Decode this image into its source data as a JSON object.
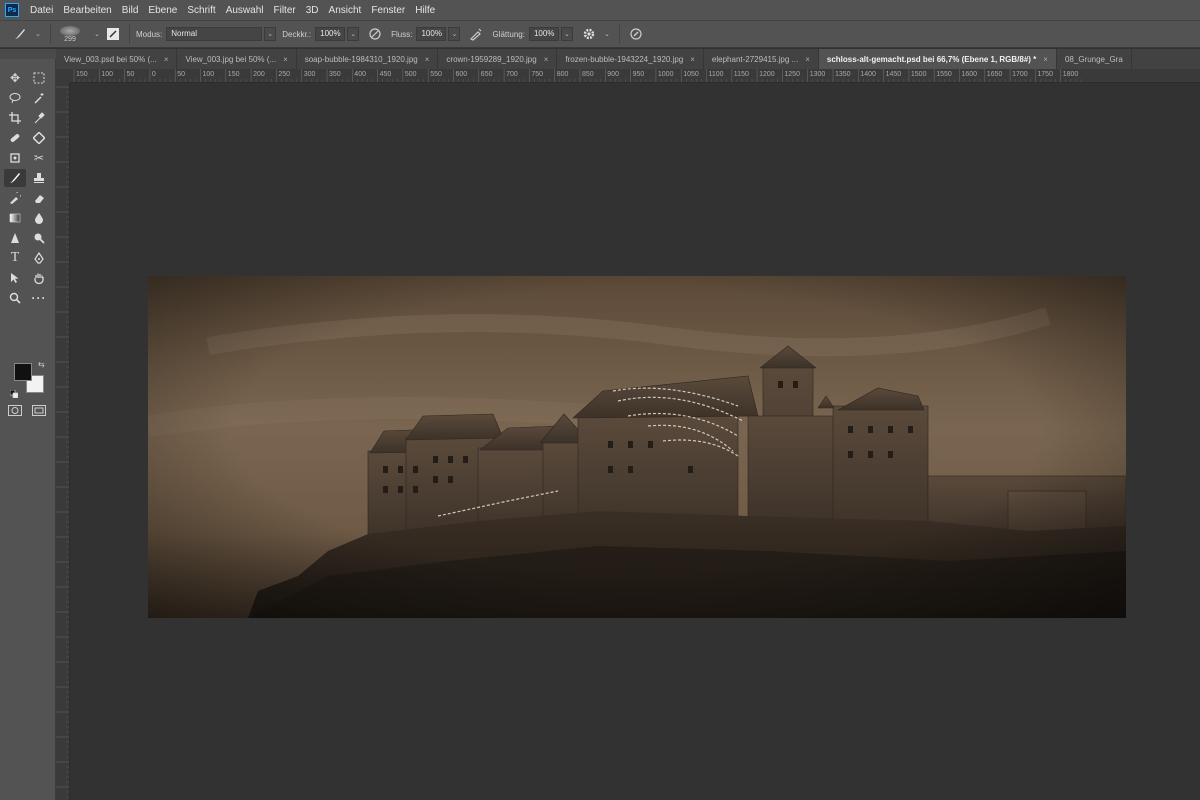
{
  "app": {
    "logo": "Ps"
  },
  "menu": [
    "Datei",
    "Bearbeiten",
    "Bild",
    "Ebene",
    "Schrift",
    "Auswahl",
    "Filter",
    "3D",
    "Ansicht",
    "Fenster",
    "Hilfe"
  ],
  "options": {
    "brush_size": "299",
    "mode_label": "Modus:",
    "mode_value": "Normal",
    "opacity_label": "Deckkr.:",
    "opacity_value": "100%",
    "flow_label": "Fluss:",
    "flow_value": "100%",
    "smoothing_label": "Glättung:",
    "smoothing_value": "100%"
  },
  "tabs": [
    {
      "label": "View_003.psd bei 50% (...",
      "active": false
    },
    {
      "label": "View_003.jpg bei 50% (...",
      "active": false
    },
    {
      "label": "soap-bubble-1984310_1920.jpg",
      "active": false
    },
    {
      "label": "crown-1959289_1920.jpg",
      "active": false
    },
    {
      "label": "frozen-bubble-1943224_1920.jpg",
      "active": false
    },
    {
      "label": "elephant-2729415.jpg ...",
      "active": false
    },
    {
      "label": "schloss-alt-gemacht.psd bei 66,7% (Ebene 1, RGB/8#) *",
      "active": true
    },
    {
      "label": "08_Grunge_Gra",
      "active": false
    }
  ],
  "ruler_top": [
    "150",
    "100",
    "50",
    "0",
    "50",
    "100",
    "150",
    "200",
    "250",
    "300",
    "350",
    "400",
    "450",
    "500",
    "550",
    "600",
    "650",
    "700",
    "750",
    "800",
    "850",
    "900",
    "950",
    "1000",
    "1050",
    "1100",
    "1150",
    "1200",
    "1250",
    "1300",
    "1350",
    "1400",
    "1450",
    "1500",
    "1550",
    "1600",
    "1650",
    "1700",
    "1750",
    "1800"
  ],
  "colors": {
    "foreground": "#111111",
    "background": "#f2f2f2",
    "accent": "#31a8ff"
  },
  "icons": {
    "move": "move-icon",
    "marquee": "rect-marquee-icon",
    "lasso": "lasso-icon",
    "magic": "magic-wand-icon",
    "crop": "crop-icon",
    "eyedropper": "eyedropper-icon",
    "healing": "healing-brush-icon",
    "patch": "patch-icon",
    "brush": "brush-icon",
    "stamp": "clone-stamp-icon",
    "history": "history-brush-icon",
    "eraser": "eraser-icon",
    "gradient": "gradient-icon",
    "blur": "blur-icon",
    "dodge": "dodge-icon",
    "pen": "pen-icon",
    "type": "type-icon",
    "path": "path-select-icon",
    "hand": "hand-icon",
    "zoom": "zoom-icon",
    "more": "more-icon"
  }
}
